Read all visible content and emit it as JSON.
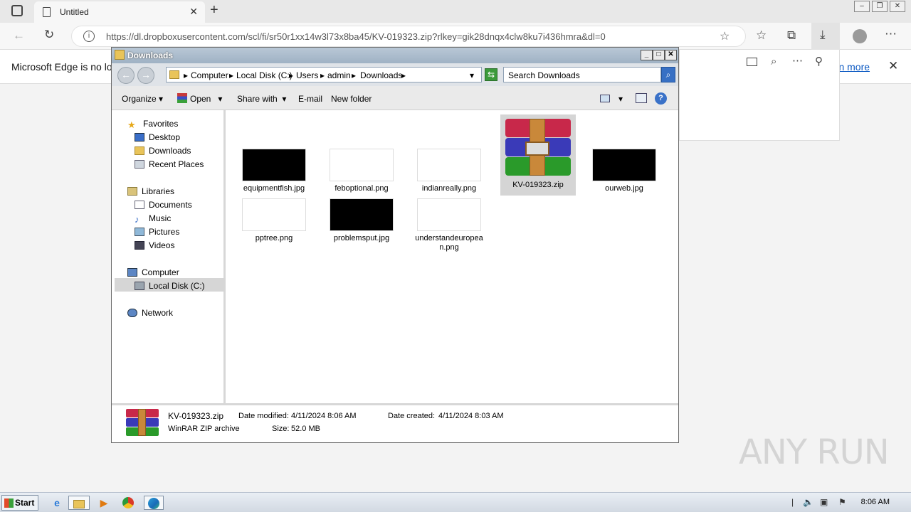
{
  "browser": {
    "tab_title": "Untitled",
    "url": "https://dl.dropboxusercontent.com/scl/fi/sr50r1xx14w3l73x8ba45/KV-019323.zip?rlkey=gik28dnqx4clw8ku7i436hmra&dl=0",
    "info_message": "Microsoft Edge is no lon",
    "info_link": "arn more"
  },
  "explorer": {
    "title": "Downloads",
    "breadcrumb": [
      "Computer",
      "Local Disk (C:)",
      "Users",
      "admin",
      "Downloads"
    ],
    "search_placeholder": "Search Downloads",
    "commands": {
      "organize": "Organize",
      "open": "Open",
      "share_with": "Share with",
      "email": "E-mail",
      "new_folder": "New folder"
    },
    "nav": {
      "favorites": "Favorites",
      "desktop": "Desktop",
      "downloads": "Downloads",
      "recent_places": "Recent Places",
      "libraries": "Libraries",
      "documents": "Documents",
      "music": "Music",
      "pictures": "Pictures",
      "videos": "Videos",
      "computer": "Computer",
      "local_disk": "Local Disk (C:)",
      "network": "Network"
    },
    "files": [
      {
        "name": "equipmentfish.jpg",
        "thumb_color": "#000000"
      },
      {
        "name": "feboptional.png",
        "thumb_color": "#ffffff"
      },
      {
        "name": "indianreally.png",
        "thumb_color": "#ffffff"
      },
      {
        "name": "KV-019323.zip",
        "thumb_color": "rar"
      },
      {
        "name": "ourweb.jpg",
        "thumb_color": "#000000"
      },
      {
        "name": "pptree.png",
        "thumb_color": "#ffffff"
      },
      {
        "name": "problemsput.jpg",
        "thumb_color": "#000000"
      },
      {
        "name": "understandeuropean.png",
        "thumb_color": "#ffffff"
      }
    ],
    "details": {
      "name": "KV-019323.zip",
      "type": "WinRAR ZIP archive",
      "modified_label": "Date modified:",
      "modified": "4/11/2024 8:06 AM",
      "size_label": "Size:",
      "size": "52.0 MB",
      "created_label": "Date created:",
      "created": "4/11/2024 8:03 AM"
    }
  },
  "taskbar": {
    "start": "Start",
    "clock": "8:06 AM"
  },
  "watermark": "ANY RUN"
}
